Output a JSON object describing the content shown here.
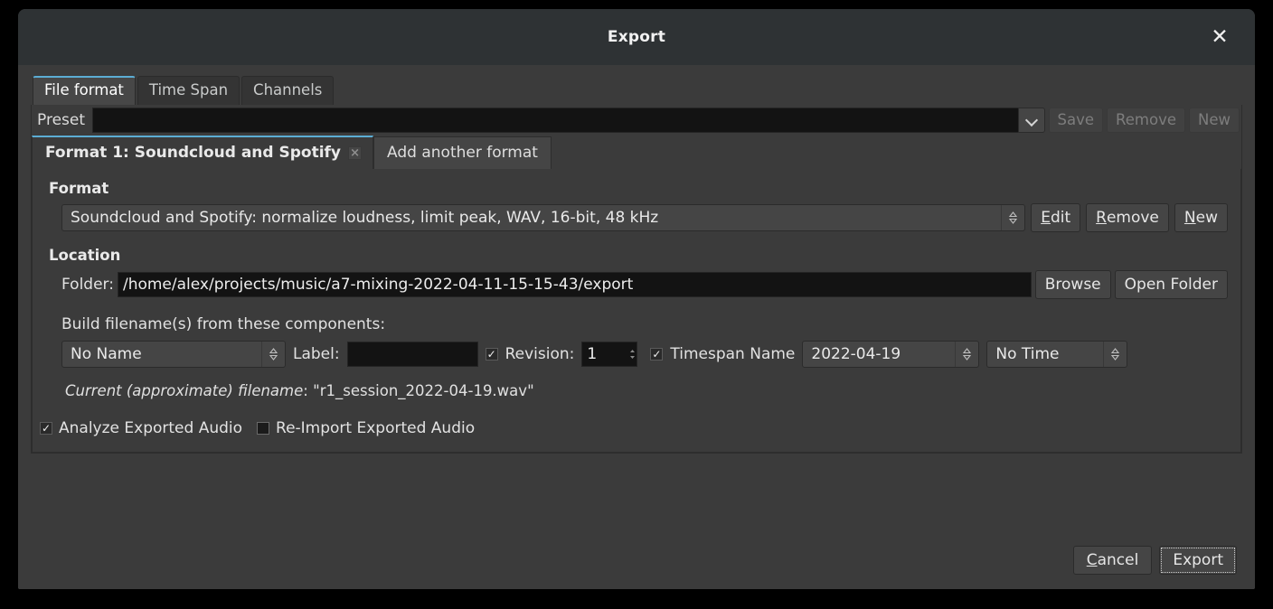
{
  "window": {
    "title": "Export",
    "close_icon": "close-icon"
  },
  "tabs": [
    {
      "label": "File format",
      "active": true
    },
    {
      "label": "Time Span",
      "active": false
    },
    {
      "label": "Channels",
      "active": false
    }
  ],
  "preset": {
    "label": "Preset",
    "value": "",
    "placeholder": "",
    "dropdown_icon": "chevron-down-icon",
    "buttons": [
      {
        "label": "Save",
        "enabled": false
      },
      {
        "label": "Remove",
        "enabled": false
      },
      {
        "label": "New",
        "enabled": false
      }
    ]
  },
  "format_tabs": {
    "active_label": "Format 1: Soundcloud and Spotify",
    "close_icon": "×",
    "add_label": "Add another format"
  },
  "format_section": {
    "heading": "Format",
    "selected": "Soundcloud and Spotify: normalize loudness, limit peak, WAV, 16-bit, 48 kHz",
    "spinner_icon": "up-down-spinner-icon",
    "buttons": [
      {
        "label": "Edit",
        "mnemonic": "E",
        "rest": "dit"
      },
      {
        "label": "Remove",
        "mnemonic": "R",
        "rest": "emove"
      },
      {
        "label": "New",
        "mnemonic": "N",
        "rest": "ew"
      }
    ]
  },
  "location_section": {
    "heading": "Location",
    "folder_label": "Folder:",
    "folder_value": "/home/alex/projects/music/a7-mixing-2022-04-11-15-15-43/export",
    "browse_label": "Browse",
    "open_folder_label": "Open Folder",
    "components_label": "Build filename(s) from these components:",
    "name_select": "No Name",
    "label_label": "Label:",
    "label_value": "",
    "revision_checked": true,
    "revision_label": "Revision:",
    "revision_value": "1",
    "timespan_checked": true,
    "timespan_label": "Timespan Name",
    "timespan_value": "2022-04-19",
    "time_select": "No Time",
    "filename_note_prefix": "Current (approximate) filename",
    "filename_note_sep": ": \"",
    "filename_note_value": "r1_session_2022-04-19.wav",
    "filename_note_suffix": "\""
  },
  "options": {
    "analyze_checked": true,
    "analyze_label": "Analyze Exported Audio",
    "reimport_checked": false,
    "reimport_label": "Re-Import Exported Audio"
  },
  "footer": {
    "cancel": {
      "mnemonic": "C",
      "rest": "ancel"
    },
    "export": {
      "label": "Export"
    }
  },
  "colors": {
    "accent": "#5cadd4",
    "window_bg": "#3b3b3b",
    "titlebar_bg": "#2e3234",
    "entry_bg": "#131313"
  }
}
